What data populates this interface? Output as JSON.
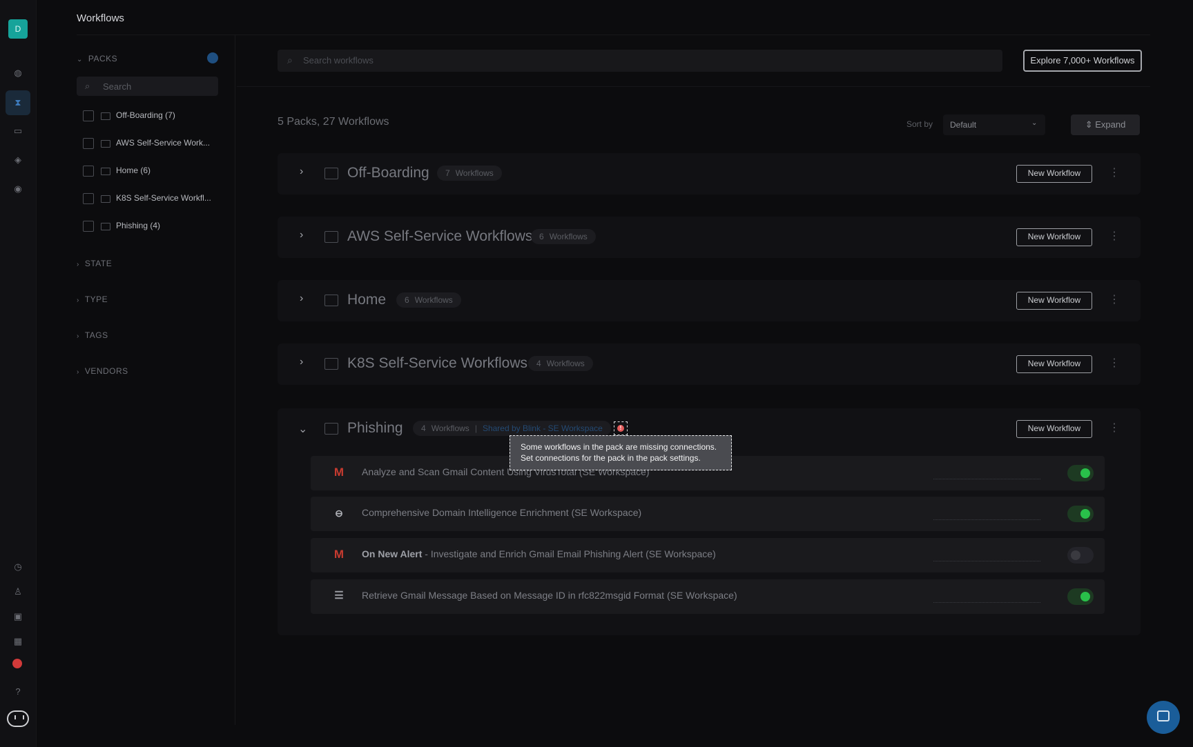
{
  "app": {
    "title": "Workflows",
    "avatar_letter": "D",
    "accent_color": "#16a39a"
  },
  "rail": {
    "top_icons": [
      "database-icon",
      "workflow-icon",
      "window-icon",
      "box-icon",
      "globe-icon"
    ],
    "bottom_icons": [
      "history-icon",
      "user-icon",
      "plugin-icon",
      "integrations-icon",
      "alert-icon",
      "help-icon",
      "assistant-icon"
    ]
  },
  "sidebar": {
    "packs_header": "PACKS",
    "search_placeholder": "Search",
    "packs": [
      {
        "label": "Off-Boarding (7)"
      },
      {
        "label": "AWS Self-Service Work..."
      },
      {
        "label": "Home (6)"
      },
      {
        "label": "K8S Self-Service Workfl..."
      },
      {
        "label": "Phishing (4)"
      }
    ],
    "sections": [
      "STATE",
      "TYPE",
      "TAGS",
      "VENDORS"
    ]
  },
  "main": {
    "search_placeholder": "Search workflows",
    "explore_button": "Explore 7,000+ Workflows",
    "summary": "5 Packs, 27 Workflows",
    "sort_label": "Sort by",
    "sort_value": "Default",
    "expand_button": "Expand",
    "new_workflow_label": "New Workflow",
    "workflows_word": "Workflows",
    "packs": [
      {
        "name": "Off-Boarding",
        "count": "7"
      },
      {
        "name": "AWS Self-Service Workflows",
        "count": "6"
      },
      {
        "name": "Home",
        "count": "6"
      },
      {
        "name": "K8S Self-Service Workflows",
        "count": "4"
      },
      {
        "name": "Phishing",
        "count": "4",
        "shared": "Shared by Blink - SE Workspace"
      }
    ],
    "workflows": [
      {
        "icon": "gmail-icon",
        "prefix": "",
        "name": "Analyze and Scan Gmail Content Using VirusTotal (SE Workspace)",
        "enabled": true
      },
      {
        "icon": "domain-intel-icon",
        "prefix": "",
        "name": "Comprehensive Domain Intelligence Enrichment (SE Workspace)",
        "enabled": true
      },
      {
        "icon": "gmail-icon",
        "prefix": "On New Alert",
        "name": " - Investigate and Enrich Gmail Email Phishing Alert (SE Workspace)",
        "enabled": false
      },
      {
        "icon": "sliders-icon",
        "prefix": "",
        "name": "Retrieve Gmail Message Based on Message ID in rfc822msgid Format (SE Workspace)",
        "enabled": true
      }
    ],
    "tooltip": "Some workflows in the pack are missing connections. Set connections for the pack in the pack settings."
  }
}
